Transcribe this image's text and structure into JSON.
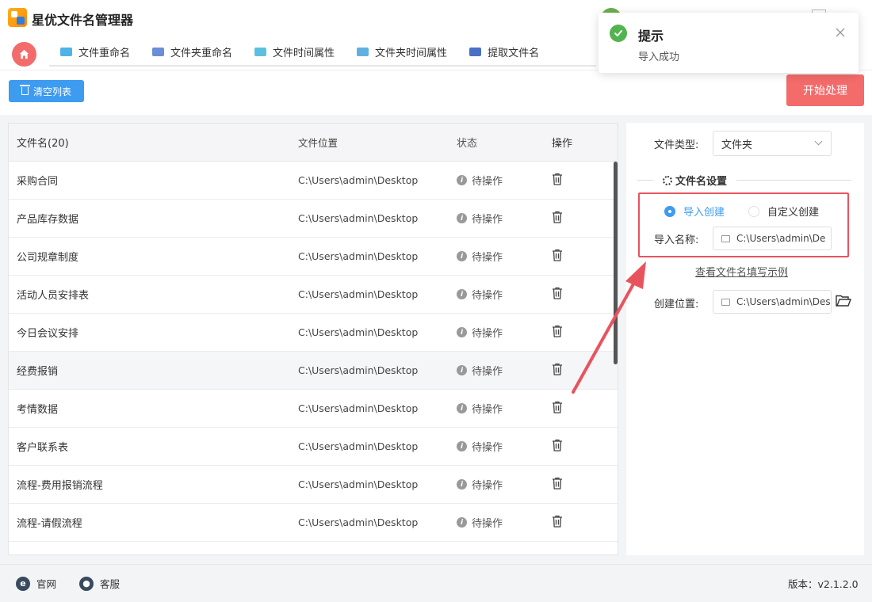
{
  "app": {
    "title": "星优文件名管理器"
  },
  "nav": {
    "tabs": [
      {
        "label": "文件重命名",
        "color": "#4fb3e8"
      },
      {
        "label": "文件夹重命名",
        "color": "#6a8fd6"
      },
      {
        "label": "文件时间属性",
        "color": "#5bc0de"
      },
      {
        "label": "文件夹时间属性",
        "color": "#5fb0e0"
      },
      {
        "label": "提取文件名",
        "color": "#4a6fc6"
      }
    ]
  },
  "toolbar": {
    "clear_label": "清空列表",
    "start_label": "开始处理"
  },
  "table": {
    "headers": {
      "name": "文件名(20)",
      "location": "文件位置",
      "status": "状态",
      "action": "操作"
    },
    "rows": [
      {
        "name": "采购合同",
        "location": "C:\\Users\\admin\\Desktop",
        "status": "待操作"
      },
      {
        "name": "产品库存数据",
        "location": "C:\\Users\\admin\\Desktop",
        "status": "待操作"
      },
      {
        "name": "公司规章制度",
        "location": "C:\\Users\\admin\\Desktop",
        "status": "待操作"
      },
      {
        "name": "活动人员安排表",
        "location": "C:\\Users\\admin\\Desktop",
        "status": "待操作"
      },
      {
        "name": "今日会议安排",
        "location": "C:\\Users\\admin\\Desktop",
        "status": "待操作"
      },
      {
        "name": "经费报销",
        "location": "C:\\Users\\admin\\Desktop",
        "status": "待操作"
      },
      {
        "name": "考情数据",
        "location": "C:\\Users\\admin\\Desktop",
        "status": "待操作"
      },
      {
        "name": "客户联系表",
        "location": "C:\\Users\\admin\\Desktop",
        "status": "待操作"
      },
      {
        "name": "流程-费用报销流程",
        "location": "C:\\Users\\admin\\Desktop",
        "status": "待操作"
      },
      {
        "name": "流程-请假流程",
        "location": "C:\\Users\\admin\\Desktop",
        "status": "待操作"
      }
    ]
  },
  "settings": {
    "file_type_label": "文件类型:",
    "file_type_value": "文件夹",
    "section_title": "文件名设置",
    "radio_import": "导入创建",
    "radio_custom": "自定义创建",
    "import_name_label": "导入名称:",
    "import_name_value": "C:\\Users\\admin\\De",
    "example_link": "查看文件名填写示例",
    "create_location_label": "创建位置:",
    "create_location_value": "C:\\Users\\admin\\Des"
  },
  "toast": {
    "title": "提示",
    "message": "导入成功"
  },
  "footer": {
    "website": "官网",
    "support": "客服",
    "version": "版本：v2.1.2.0"
  },
  "colors": {
    "primary": "#3d9bf0",
    "danger": "#f36b6b",
    "success": "#52b44f",
    "highlight": "#e8545e"
  }
}
